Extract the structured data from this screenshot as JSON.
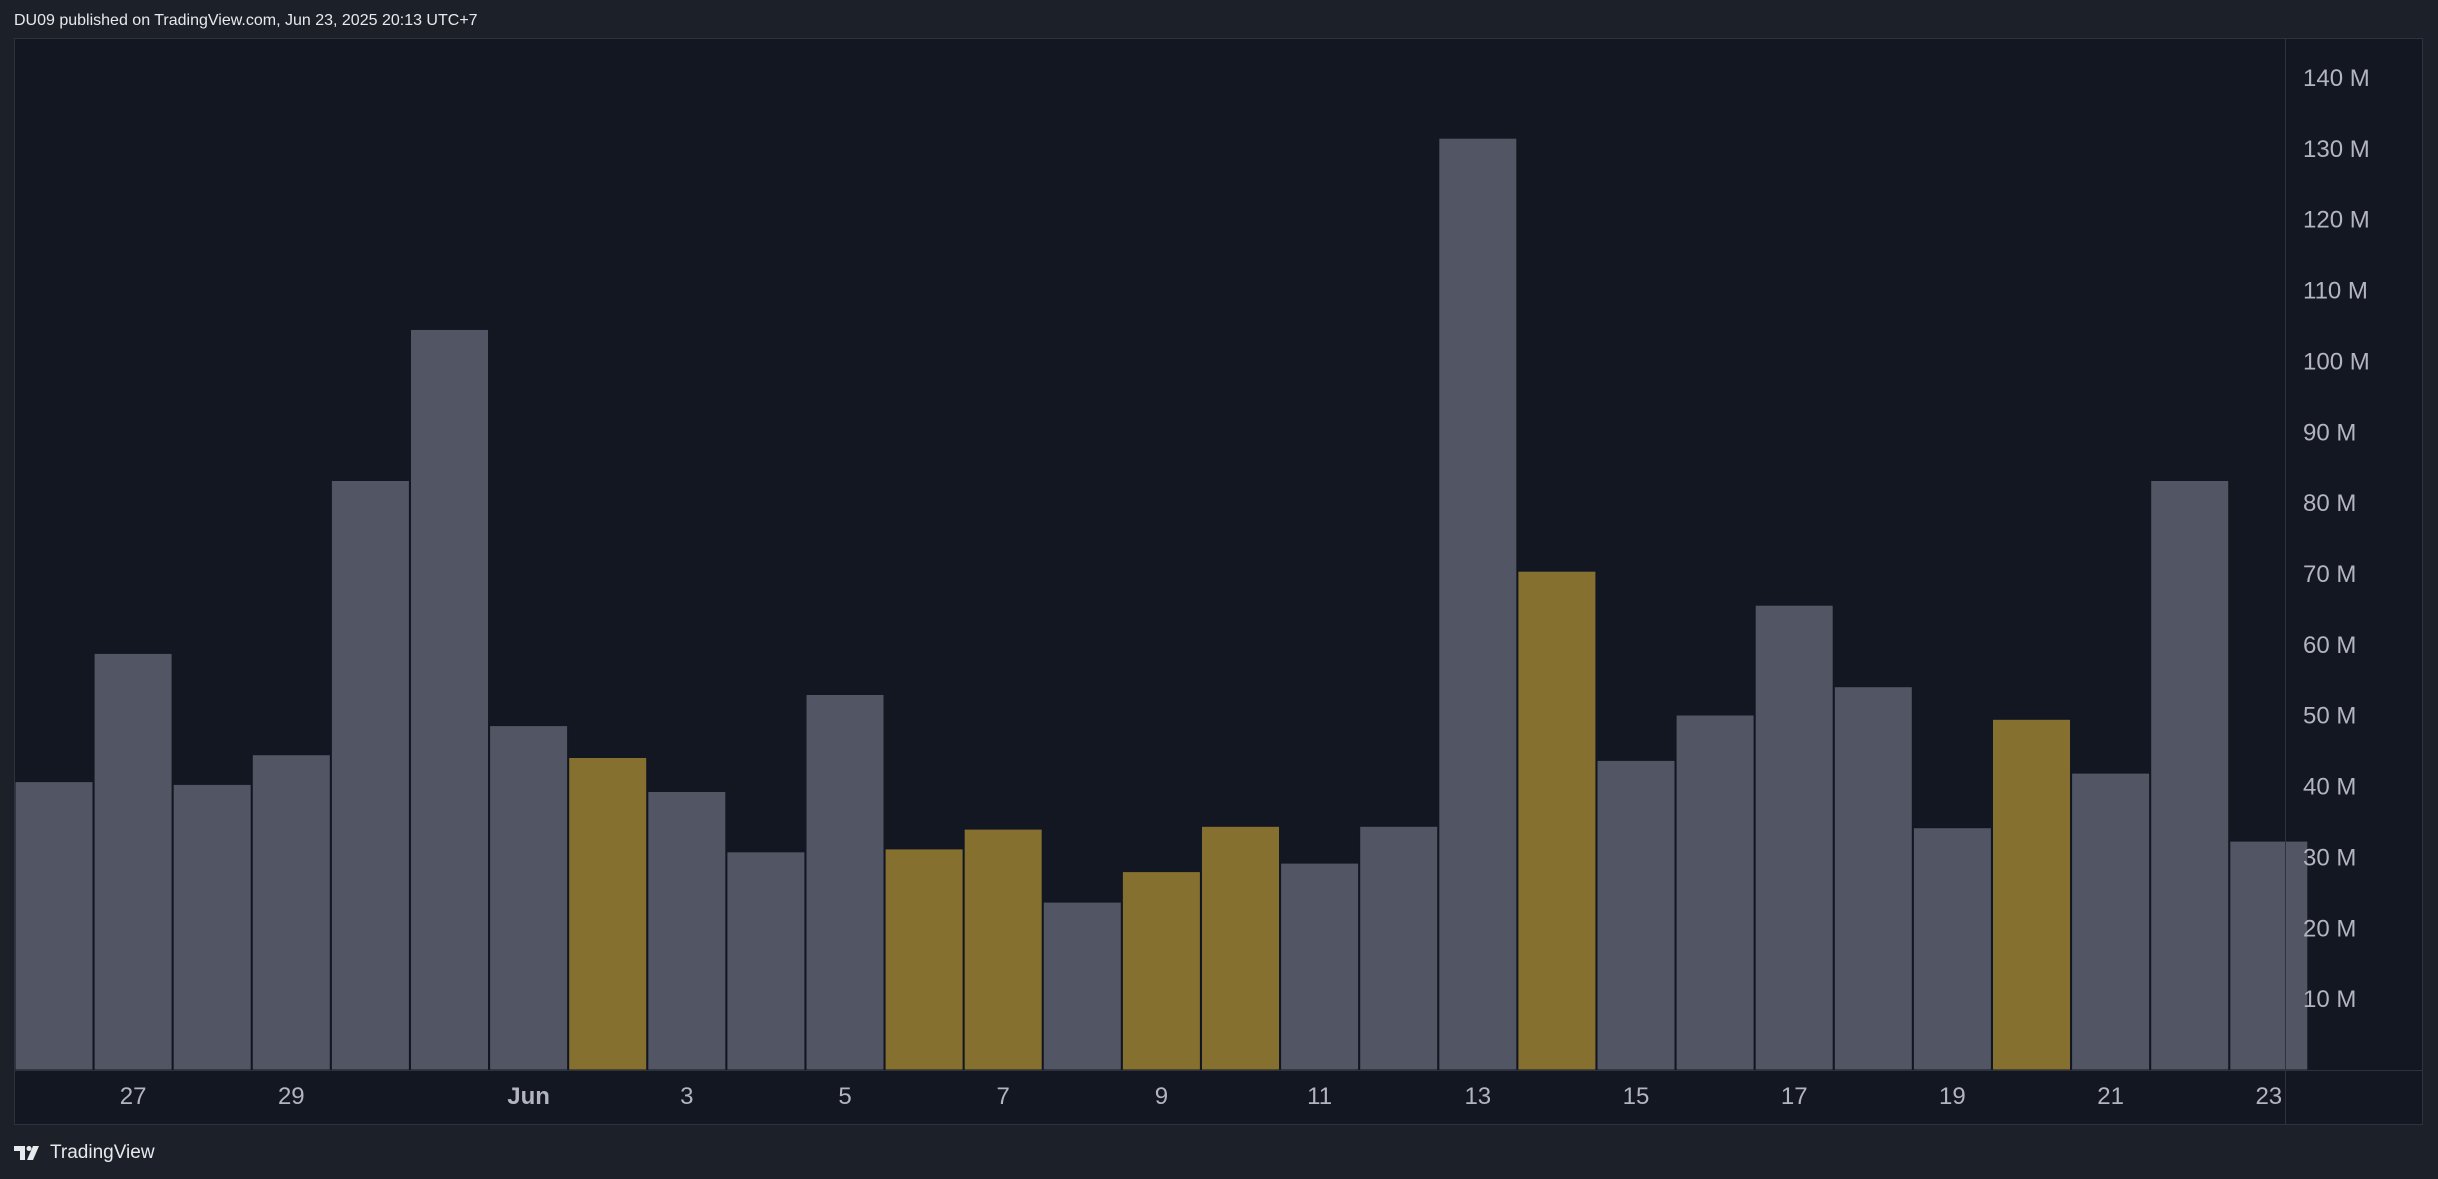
{
  "header": {
    "published_text": "DU09 published on TradingView.com, Jun 23, 2025 20:13 UTC+7"
  },
  "footer": {
    "brand": "TradingView"
  },
  "colors": {
    "background": "#131722",
    "up_volume": "#525563",
    "down_volume": "#85702f",
    "axis_text": "#b2b5be"
  },
  "chart_data": {
    "type": "bar",
    "x": [
      "May 26",
      "May 27",
      "May 28",
      "May 29",
      "May 30",
      "May 31",
      "Jun 1",
      "Jun 2",
      "Jun 3",
      "Jun 4",
      "Jun 5",
      "Jun 6",
      "Jun 7",
      "Jun 8",
      "Jun 9",
      "Jun 10",
      "Jun 11",
      "Jun 12",
      "Jun 13",
      "Jun 14",
      "Jun 15",
      "Jun 16",
      "Jun 17",
      "Jun 18",
      "Jun 19",
      "Jun 20",
      "Jun 21",
      "Jun 22",
      "Jun 23"
    ],
    "values": [
      40.7,
      58.8,
      40.3,
      44.5,
      83.2,
      104.5,
      48.6,
      44.1,
      39.3,
      30.8,
      53.0,
      31.2,
      34.0,
      23.7,
      28.0,
      34.4,
      29.2,
      34.4,
      131.5,
      70.4,
      43.7,
      50.1,
      65.6,
      54.1,
      34.2,
      49.5,
      41.9,
      83.2,
      32.3
    ],
    "direction": [
      "up",
      "up",
      "up",
      "up",
      "up",
      "up",
      "up",
      "down",
      "up",
      "up",
      "up",
      "down",
      "down",
      "up",
      "down",
      "down",
      "up",
      "up",
      "up",
      "down",
      "up",
      "up",
      "up",
      "up",
      "up",
      "down",
      "up",
      "up",
      "up"
    ],
    "unit": "M",
    "ylim": [
      0,
      145
    ],
    "y_ticks": [
      "140 M",
      "130 M",
      "120 M",
      "110 M",
      "100 M",
      "90 M",
      "80 M",
      "70 M",
      "60 M",
      "50 M",
      "40 M",
      "30 M",
      "20 M",
      "10 M"
    ],
    "x_tick_labels": [
      {
        "index": 1,
        "label": "27"
      },
      {
        "index": 3,
        "label": "29"
      },
      {
        "index": 6,
        "label": "Jun"
      },
      {
        "index": 8,
        "label": "3"
      },
      {
        "index": 10,
        "label": "5"
      },
      {
        "index": 12,
        "label": "7"
      },
      {
        "index": 14,
        "label": "9"
      },
      {
        "index": 16,
        "label": "11"
      },
      {
        "index": 18,
        "label": "13"
      },
      {
        "index": 20,
        "label": "15"
      },
      {
        "index": 22,
        "label": "17"
      },
      {
        "index": 24,
        "label": "19"
      },
      {
        "index": 26,
        "label": "21"
      },
      {
        "index": 28,
        "label": "23"
      }
    ],
    "grid": false,
    "title": "",
    "xlabel": "",
    "ylabel": ""
  }
}
